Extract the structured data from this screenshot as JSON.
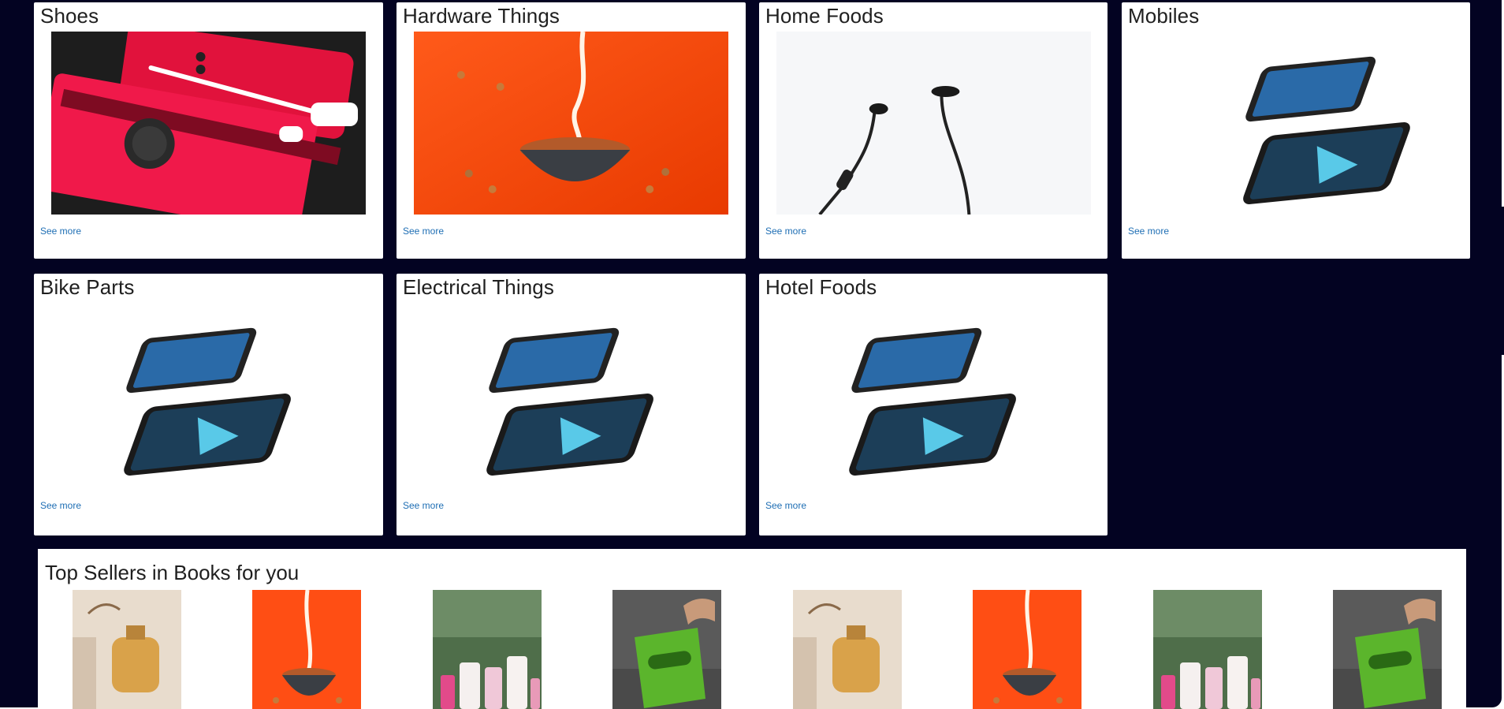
{
  "categories": [
    {
      "title": "Shoes",
      "image": "red-devices-photo",
      "link": "See more"
    },
    {
      "title": "Hardware Things",
      "image": "cereal-bowl-photo",
      "link": "See more"
    },
    {
      "title": "Home Foods",
      "image": "earphones-photo",
      "link": "See more"
    },
    {
      "title": "Mobiles",
      "image": "smartphones-photo",
      "link": "See more"
    },
    {
      "title": "Bike Parts",
      "image": "smartphones-photo",
      "link": "See more"
    },
    {
      "title": "Electrical Things",
      "image": "smartphones-photo",
      "link": "See more"
    },
    {
      "title": "Hotel Foods",
      "image": "smartphones-photo",
      "link": "See more"
    }
  ],
  "top_sellers": {
    "title": "Top Sellers in Books for you",
    "items": [
      "perfume-photo",
      "cereal-bowl-photo",
      "cosmetics-photo",
      "chips-bag-photo",
      "perfume-photo",
      "cereal-bowl-photo",
      "cosmetics-photo",
      "chips-bag-photo"
    ]
  },
  "colors": {
    "background": "#030322",
    "card": "#ffffff",
    "link": "#1e6eb4"
  }
}
